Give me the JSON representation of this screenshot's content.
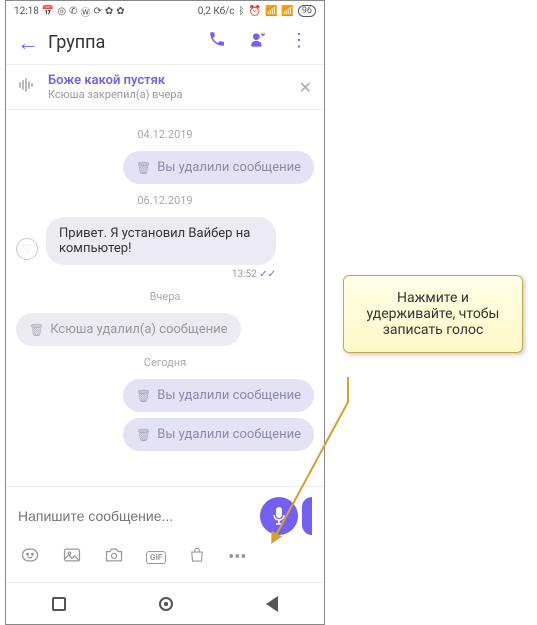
{
  "status_bar": {
    "time": "12:18",
    "data_rate": "0,2 Кб/с",
    "battery": "96"
  },
  "header": {
    "title": "Группа"
  },
  "pinned": {
    "title": "Боже какой пустяк",
    "subtitle": "Ксюша закрепил(а) вчера"
  },
  "messages": [
    {
      "type": "date",
      "text": "04.12.2019"
    },
    {
      "type": "deleted_out",
      "text": "Вы удалили сообщение"
    },
    {
      "type": "date",
      "text": "06.12.2019"
    },
    {
      "type": "incoming",
      "text": "Привет. Я установил Вайбер на компьютер!",
      "time": "13:52"
    },
    {
      "type": "date",
      "text": "Вчера"
    },
    {
      "type": "deleted_neutral",
      "text": "Ксюша удалил(а) сообщение"
    },
    {
      "type": "date",
      "text": "Сегодня"
    },
    {
      "type": "deleted_out",
      "text": "Вы удалили сообщение"
    },
    {
      "type": "deleted_out",
      "text": "Вы удалили сообщение"
    }
  ],
  "input": {
    "placeholder": "Напишите сообщение..."
  },
  "icon_row": {
    "gif": "GIF"
  },
  "callout": {
    "text": "Нажмите и удерживайте, чтобы записать голос"
  }
}
